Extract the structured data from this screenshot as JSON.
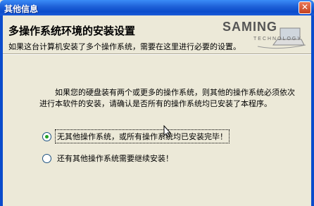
{
  "window": {
    "title": "其他信息",
    "close_glyph": "✕"
  },
  "header": {
    "title": "多操作系统环境的安装设置",
    "subtitle": "如果这台计算机安装了多个操作系统，需要在这里进行必要的设置。",
    "logo_text": "SAMING",
    "logo_sub": "TECHNOLOGY"
  },
  "body": {
    "description": "如果您的硬盘装有两个或更多的操作系统，则其他的操作系统必须依次进行本软件的安装，请确认是否所有的操作系统均已安装了本程序。",
    "options": [
      {
        "label": "无其他操作系统，或所有操作系统均已安装完毕！",
        "selected": true
      },
      {
        "label": "还有其他操作系统需要继续安装！",
        "selected": false
      }
    ]
  },
  "colors": {
    "titlebar": "#0b4ccc",
    "background": "#ece9d8",
    "radio_dot": "#21a121"
  }
}
